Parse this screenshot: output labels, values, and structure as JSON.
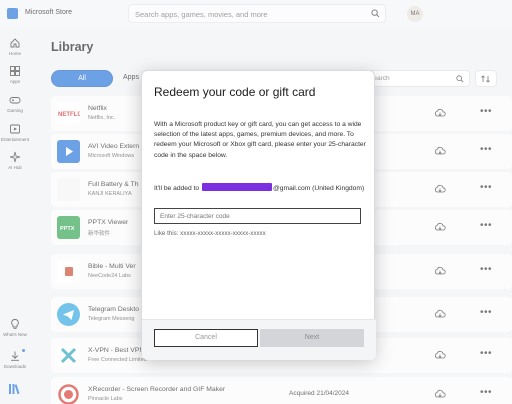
{
  "window": {
    "title": "Microsoft Store"
  },
  "search": {
    "placeholder": "Search apps, games, movies, and more"
  },
  "user": {
    "initials": "MA"
  },
  "sidebar": {
    "items": [
      {
        "label": "Home"
      },
      {
        "label": "Apps"
      },
      {
        "label": "Gaming"
      },
      {
        "label": "Entertainment"
      },
      {
        "label": "AI Hub"
      },
      {
        "label": "What's New"
      },
      {
        "label": "Downloads"
      }
    ]
  },
  "library": {
    "title": "Library",
    "filter_all": "All",
    "filter_apps": "Apps",
    "search_placeholder": "Search",
    "rows": [
      {
        "name": "Netflix",
        "publisher": "Netflix, Inc.",
        "acquired": ""
      },
      {
        "name": "AVI Video Extern",
        "publisher": "Microsoft Windows",
        "acquired": ""
      },
      {
        "name": "Full Battery & Th",
        "publisher": "KANJI KERALIYA",
        "acquired": ""
      },
      {
        "name": "PPTX Viewer",
        "publisher": "新华软件",
        "acquired": ""
      },
      {
        "name": "Bible - Multi Ver",
        "publisher": "NeeCode24 Labs",
        "acquired": ""
      },
      {
        "name": "Telegram Deskto",
        "publisher": "Telegram Messeng",
        "acquired": ""
      },
      {
        "name": "X-VPN - Best VPN",
        "publisher": "Free Connected Limited",
        "acquired": ""
      },
      {
        "name": "XRecorder - Screen Recorder and GIF Maker",
        "publisher": "Pinnacle Labs",
        "acquired": "Acquired 21/04/2024"
      }
    ]
  },
  "dialog": {
    "title": "Redeem your code or gift card",
    "body": "With a Microsoft product key or gift card, you can get access to a wide selection of the latest apps, games, premium devices, and more. To redeem your Microsoft or Xbox gift card, please enter your 25-character code in the space below.",
    "added_prefix": "It'll be added to",
    "added_suffix": "@gmail.com (United Kingdom)",
    "input_placeholder": "Enter 25-character code",
    "hint": "Like this: xxxxx-xxxxx-xxxxx-xxxxx-xxxxx",
    "cancel_label": "Cancel",
    "next_label": "Next"
  },
  "colors": {
    "accent": "#1f6fd8",
    "redaction": "#7b2fe0"
  }
}
